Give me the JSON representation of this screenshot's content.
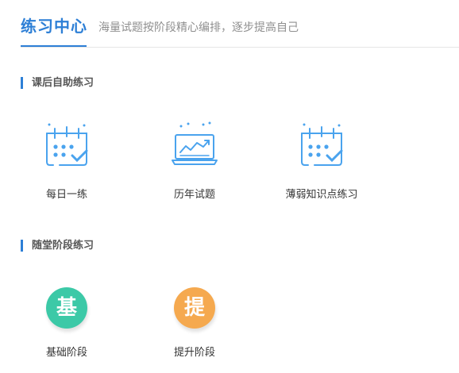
{
  "header": {
    "title": "练习中心",
    "subtitle": "海量试题按阶段精心编排，逐步提高自己"
  },
  "sections": [
    {
      "title": "课后自助练习",
      "items": [
        {
          "label": "每日一练",
          "icon": "calendar-check-icon"
        },
        {
          "label": "历年试题",
          "icon": "laptop-chart-icon"
        },
        {
          "label": "薄弱知识点练习",
          "icon": "calendar-check-icon"
        }
      ]
    },
    {
      "title": "随堂阶段练习",
      "items": [
        {
          "label": "基础阶段",
          "badge": "基",
          "color": "#3cc9a7",
          "icon": "basic-stage-badge-icon"
        },
        {
          "label": "提升阶段",
          "badge": "提",
          "color": "#f5a94f",
          "icon": "advanced-stage-badge-icon"
        }
      ]
    }
  ],
  "colors": {
    "accent": "#2d7fd6",
    "icon_blue": "#4aa3ee",
    "teal": "#3cc9a7",
    "orange": "#f5a94f"
  }
}
